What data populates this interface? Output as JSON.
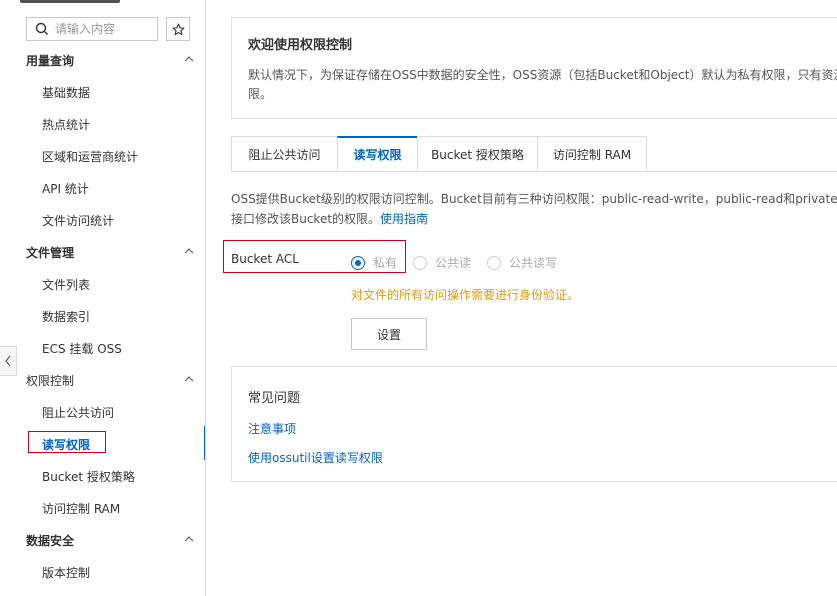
{
  "sidebar": {
    "search_placeholder": "请输入内容",
    "groups": [
      {
        "label": "用量查询",
        "items": [
          "基础数据",
          "热点统计",
          "区域和运营商统计",
          "API 统计",
          "文件访问统计"
        ]
      },
      {
        "label": "文件管理",
        "items": [
          "文件列表",
          "数据索引",
          "ECS 挂载 OSS"
        ]
      },
      {
        "label": "权限控制",
        "items": [
          "阻止公共访问",
          "读写权限",
          "Bucket 授权策略",
          "访问控制 RAM"
        ]
      },
      {
        "label": "数据安全",
        "items": [
          "版本控制"
        ]
      }
    ],
    "active_item": "读写权限"
  },
  "welcome": {
    "title": "欢迎使用权限控制",
    "desc": "默认情况下，为保证存储在OSS中数据的安全性，OSS资源（包括Bucket和Object）默认为私有权限，只有资源拥有者或者被授权的用户允许访问，如果要授权其他用户访问或使用OSS资源，可以根据实际需求设置不同的访问权限。",
    "desc_visible_line1": "默认情况下，为保证存储在OSS中数据的安全性，OSS资源（包括Bucket和Object）默认为私有权限，只有资源拥",
    "desc_visible_line2": "限。"
  },
  "tabs": [
    {
      "label": "阻止公共访问",
      "active": false
    },
    {
      "label": "读写权限",
      "active": true
    },
    {
      "label": "Bucket 授权策略",
      "active": false
    },
    {
      "label": "访问控制 RAM",
      "active": false
    }
  ],
  "info": {
    "line1": "OSS提供Bucket级别的权限访问控制。Bucket目前有三种访问权限：public-read-write，public-read和private，对于",
    "line2_prefix": "接口修改该Bucket的权限。",
    "guide_link": "使用指南"
  },
  "acl": {
    "label": "Bucket ACL",
    "options": [
      {
        "label": "私有",
        "checked": true
      },
      {
        "label": "公共读",
        "checked": false
      },
      {
        "label": "公共读写",
        "checked": false
      }
    ],
    "warning": "对文件的所有访问操作需要进行身份验证。",
    "set_button": "设置"
  },
  "faq": {
    "title": "常见问题",
    "links": [
      "注意事项",
      "使用ossutil设置读写权限"
    ]
  },
  "colors": {
    "accent": "#0064c8",
    "warning": "#e39a07",
    "highlight_border": "#d0021b"
  }
}
